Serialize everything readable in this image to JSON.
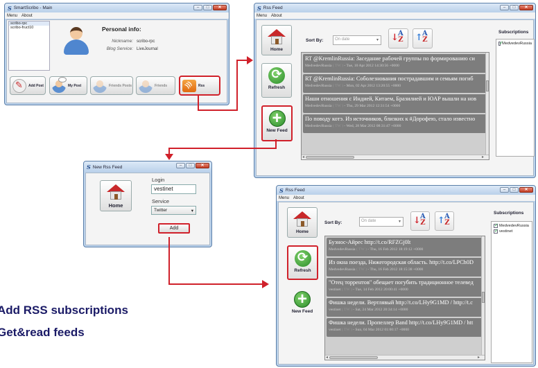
{
  "colors": {
    "accent_red": "#d0202a",
    "title_blue": "#1a1a66",
    "feed_item_bg": "#7d7d7d"
  },
  "main_window": {
    "title": "SmartScribo - Main",
    "app_icon": "S",
    "menu": [
      "Menu",
      "About"
    ],
    "users": [
      "scribo-rpc",
      "scribo-fruct10"
    ],
    "personal_info_title": "Personal info:",
    "nickname_label": "Nickname:",
    "nickname_value": "scribo-rpc",
    "blog_service_label": "Blog Service:",
    "blog_service_value": "LiveJournal",
    "toolbar": [
      {
        "label": "Add Post",
        "icon": "pen-icon"
      },
      {
        "label": "My Post",
        "icon": "person-icon"
      },
      {
        "label": "Friends Posts",
        "icon": "friends-icon"
      },
      {
        "label": "Friends",
        "icon": "person-icon"
      },
      {
        "label": "Rss",
        "icon": "rss-icon"
      }
    ]
  },
  "new_feed_window": {
    "title": "New Rss Feed",
    "app_icon": "S",
    "home_label": "Home",
    "login_label": "Login",
    "login_value": "vestinet",
    "service_label": "Service",
    "service_value": "Twitter",
    "add_label": "Add"
  },
  "rss_window_1": {
    "title": "Rss Feed",
    "app_icon": "S",
    "menu": [
      "Menu",
      "About"
    ],
    "sort_label": "Sort By:",
    "sort_value": "On date",
    "home_label": "Home",
    "refresh_label": "Refresh",
    "new_feed_label": "New Feed",
    "subscriptions_label": "Subscriptions",
    "subscriptions": [
      {
        "name": "MedvedevRussia",
        "checked": true
      }
    ],
    "feeds": [
      {
        "title": "RT @KremlinRussia: Заседание рабочей группы по формированию си",
        "author": "MedvedevRussia",
        "source": "( TW )",
        "date": "Tue, 10 Apr 2012 14:30:56 +0000"
      },
      {
        "title": "RT @KremlinRussia: Соболезнования пострадавшим и семьям погиб",
        "author": "MedvedevRussia",
        "source": "( TW )",
        "date": "Mon, 02 Apr 2012 13:20:55 +0000"
      },
      {
        "title": "Наши отношения с Индией, Китаем, Бразилией и ЮАР вышли на нов",
        "author": "MedvedevRussia",
        "source": "( TW )",
        "date": "Thu, 29 Mar 2012 12:31:54 +0000"
      },
      {
        "title": "По поводу котэ. Из источников, близких к #Дорофею, стало известно",
        "author": "MedvedevRussia",
        "source": "( TW )",
        "date": "Wed, 28 Mar 2012 08:31:47 +0000"
      }
    ]
  },
  "rss_window_2": {
    "title": "Rss Feed",
    "app_icon": "S",
    "menu": [
      "Menu",
      "About"
    ],
    "sort_label": "Sort By:",
    "sort_value": "On date",
    "home_label": "Home",
    "refresh_label": "Refresh",
    "new_feed_label": "New Feed",
    "subscriptions_label": "Subscriptions",
    "subscriptions": [
      {
        "name": "MedvedevRussia",
        "checked": true
      },
      {
        "name": "vestinet",
        "checked": true
      }
    ],
    "feeds": [
      {
        "title": "Буэнос-Айрес http://t.co/RFZGj0lt",
        "author": "MedvedevRussia",
        "source": "( TW )",
        "date": "Thu, 16 Feb 2012 18:19:12 +0000"
      },
      {
        "title": "Из окна поезда, Нижегородская область. http://t.co/LPCh0D",
        "author": "MedvedevRussia",
        "source": "( TW )",
        "date": "Thu, 16 Feb 2012 18:15:38 +0000"
      },
      {
        "title": "\"Отец торрентов\" обещает погубить традиционное телевед",
        "author": "vestinet",
        "source": "( TW )",
        "date": "Tue, 14 Feb 2012 20:00:41 +0000"
      },
      {
        "title": "Фишка недели. Вертлявый http://t.co/LHy9G1MD / http://t.c",
        "author": "vestinet",
        "source": "( TW )",
        "date": "Sat, 24 Mar 2012 20:34:14 +0000"
      },
      {
        "title": "Фишка недели. Пропеллер Band http://t.co/LHy9G1MD / htt",
        "author": "vestinet",
        "source": "( TW )",
        "date": "Sun, 04 Mar 2012 01:00:17 +0000"
      }
    ]
  },
  "captions": {
    "line1": "Add RSS subscriptions",
    "line2": "Get&read feeds"
  }
}
